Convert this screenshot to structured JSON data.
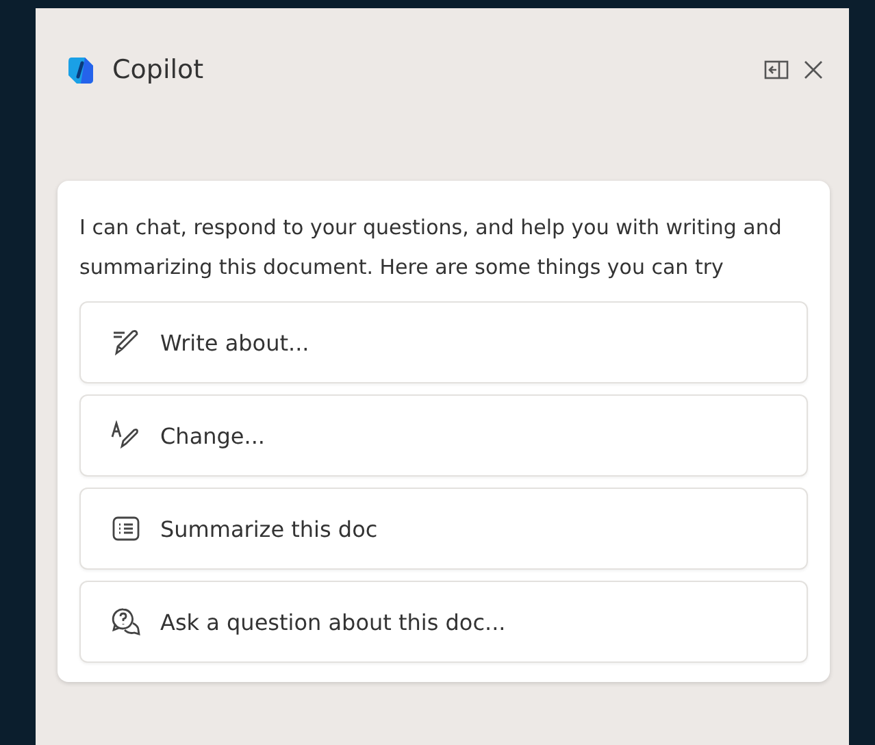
{
  "header": {
    "title": "Copilot"
  },
  "card": {
    "intro": "I can chat, respond to your questions, and help you with writing and summarizing this document. Here are some things you can try",
    "suggestions": [
      {
        "kind": "write",
        "label": "Write about..."
      },
      {
        "kind": "change",
        "label": "Change..."
      },
      {
        "kind": "summarize",
        "label": "Summarize this doc"
      },
      {
        "kind": "ask",
        "label": "Ask a question about this doc..."
      }
    ]
  }
}
